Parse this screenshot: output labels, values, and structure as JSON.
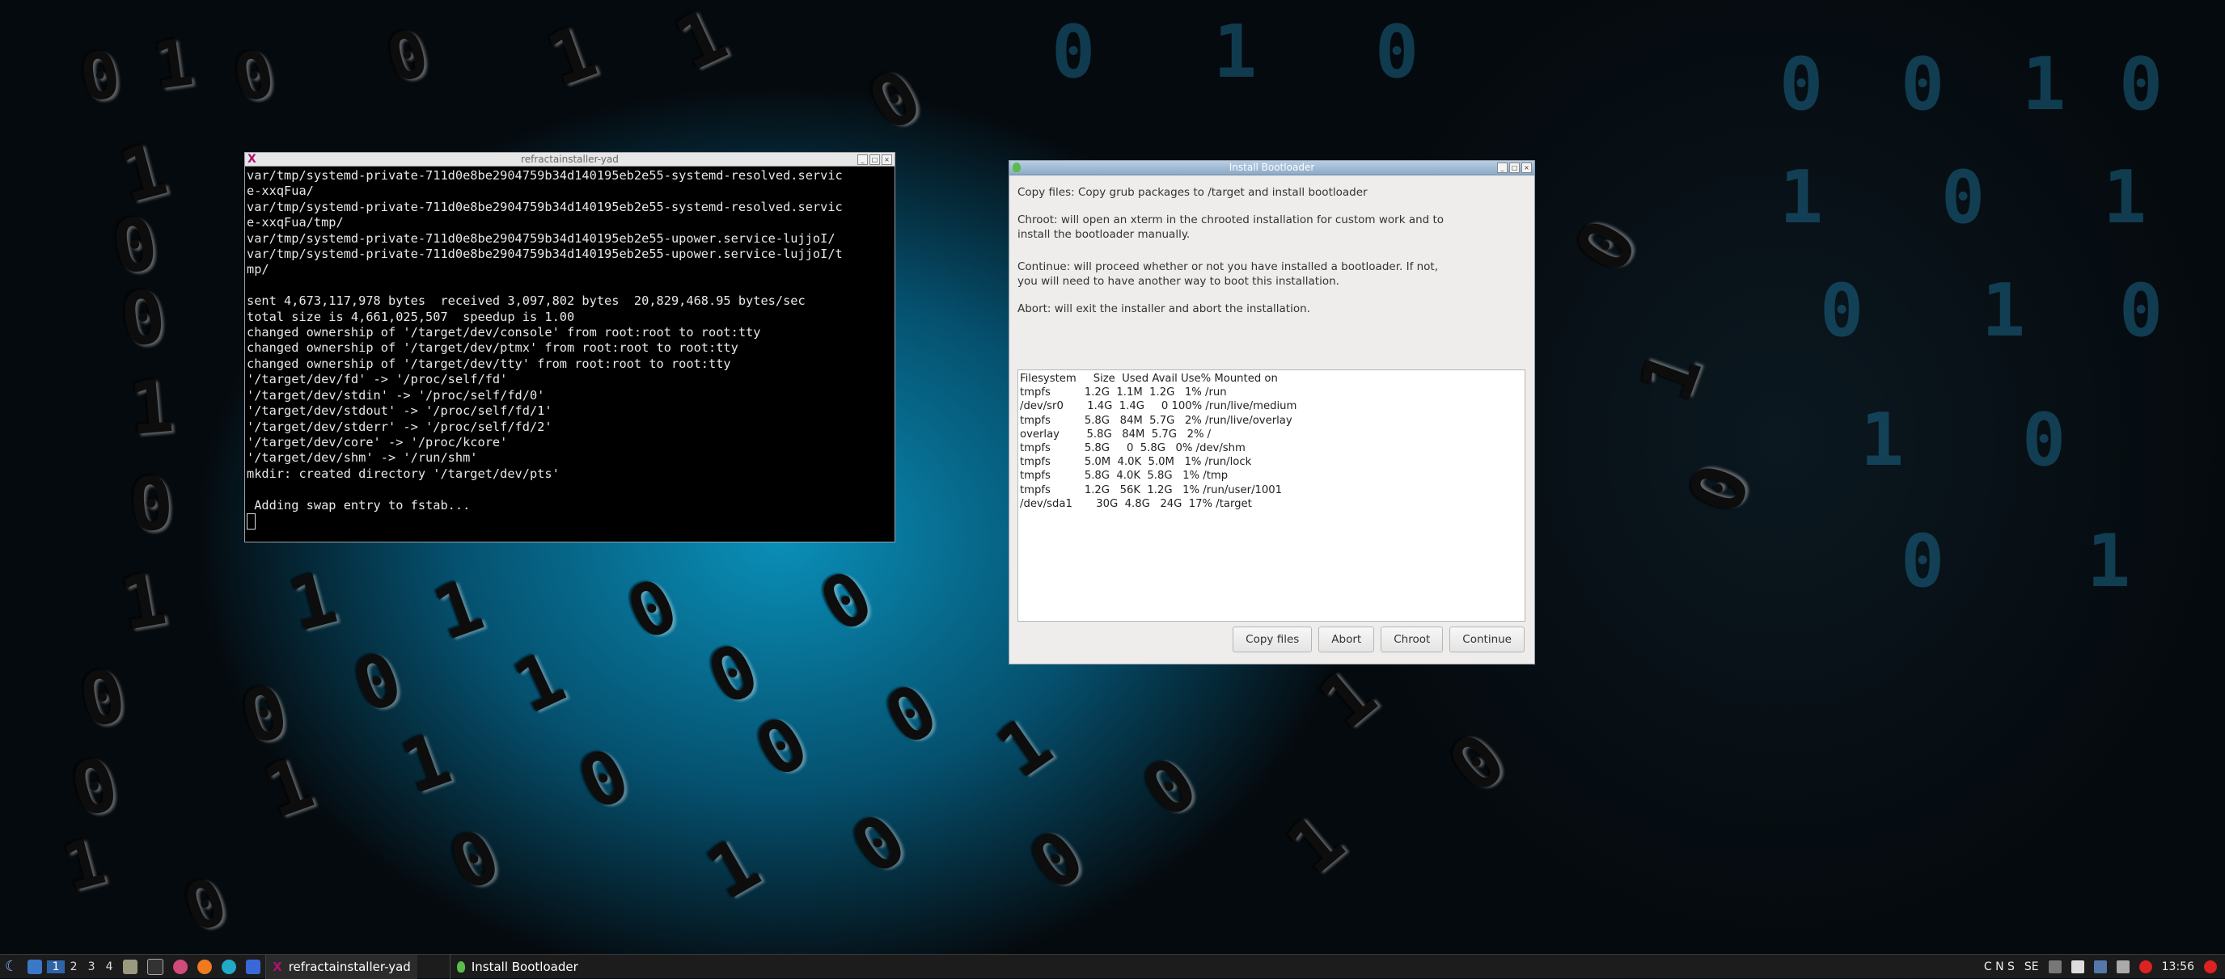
{
  "terminal": {
    "title": "refractainstaller-yad",
    "lines": [
      "var/tmp/systemd-private-711d0e8be2904759b34d140195eb2e55-systemd-resolved.servic",
      "e-xxqFua/",
      "var/tmp/systemd-private-711d0e8be2904759b34d140195eb2e55-systemd-resolved.servic",
      "e-xxqFua/tmp/",
      "var/tmp/systemd-private-711d0e8be2904759b34d140195eb2e55-upower.service-lujjoI/",
      "var/tmp/systemd-private-711d0e8be2904759b34d140195eb2e55-upower.service-lujjoI/t",
      "mp/",
      "",
      "sent 4,673,117,978 bytes  received 3,097,802 bytes  20,829,468.95 bytes/sec",
      "total size is 4,661,025,507  speedup is 1.00",
      "changed ownership of '/target/dev/console' from root:root to root:tty",
      "changed ownership of '/target/dev/ptmx' from root:root to root:tty",
      "changed ownership of '/target/dev/tty' from root:root to root:tty",
      "'/target/dev/fd' -> '/proc/self/fd'",
      "'/target/dev/stdin' -> '/proc/self/fd/0'",
      "'/target/dev/stdout' -> '/proc/self/fd/1'",
      "'/target/dev/stderr' -> '/proc/self/fd/2'",
      "'/target/dev/core' -> '/proc/kcore'",
      "'/target/dev/shm' -> '/run/shm'",
      "mkdir: created directory '/target/dev/pts'",
      "",
      " Adding swap entry to fstab..."
    ]
  },
  "dialog": {
    "title": "Install Bootloader",
    "copy_files_text": "Copy files: Copy grub packages to /target and install bootloader",
    "chroot_text": "Chroot: will open an xterm in the chrooted installation for custom work and to\ninstall the bootloader manually.",
    "continue_text": "Continue: will proceed whether or not you have installed a bootloader. If not,\nyou will need to have another way to boot this installation.",
    "abort_text": "Abort: will exit the installer and abort the installation.",
    "df_output": "Filesystem     Size  Used Avail Use% Mounted on\ntmpfs          1.2G  1.1M  1.2G   1% /run\n/dev/sr0       1.4G  1.4G     0 100% /run/live/medium\ntmpfs          5.8G   84M  5.7G   2% /run/live/overlay\noverlay        5.8G   84M  5.7G   2% /\ntmpfs          5.8G     0  5.8G   0% /dev/shm\ntmpfs          5.0M  4.0K  5.0M   1% /run/lock\ntmpfs          5.8G  4.0K  5.8G   1% /tmp\ntmpfs          1.2G   56K  1.2G   1% /run/user/1001\n/dev/sda1       30G  4.8G   24G  17% /target",
    "buttons": {
      "copy_files": "Copy files",
      "abort": "Abort",
      "chroot": "Chroot",
      "continue": "Continue"
    }
  },
  "taskbar": {
    "workspaces": [
      "1",
      "2",
      "3",
      "4"
    ],
    "tasks": [
      {
        "label": "refractainstaller-yad"
      },
      {
        "label": "Install Bootloader"
      }
    ],
    "keyboard_indicators": "C N S",
    "keyboard_layout": "SE",
    "clock": "13:56"
  },
  "colors": {
    "accent": "#2f64a8",
    "dialog_title": "#8daac7"
  }
}
